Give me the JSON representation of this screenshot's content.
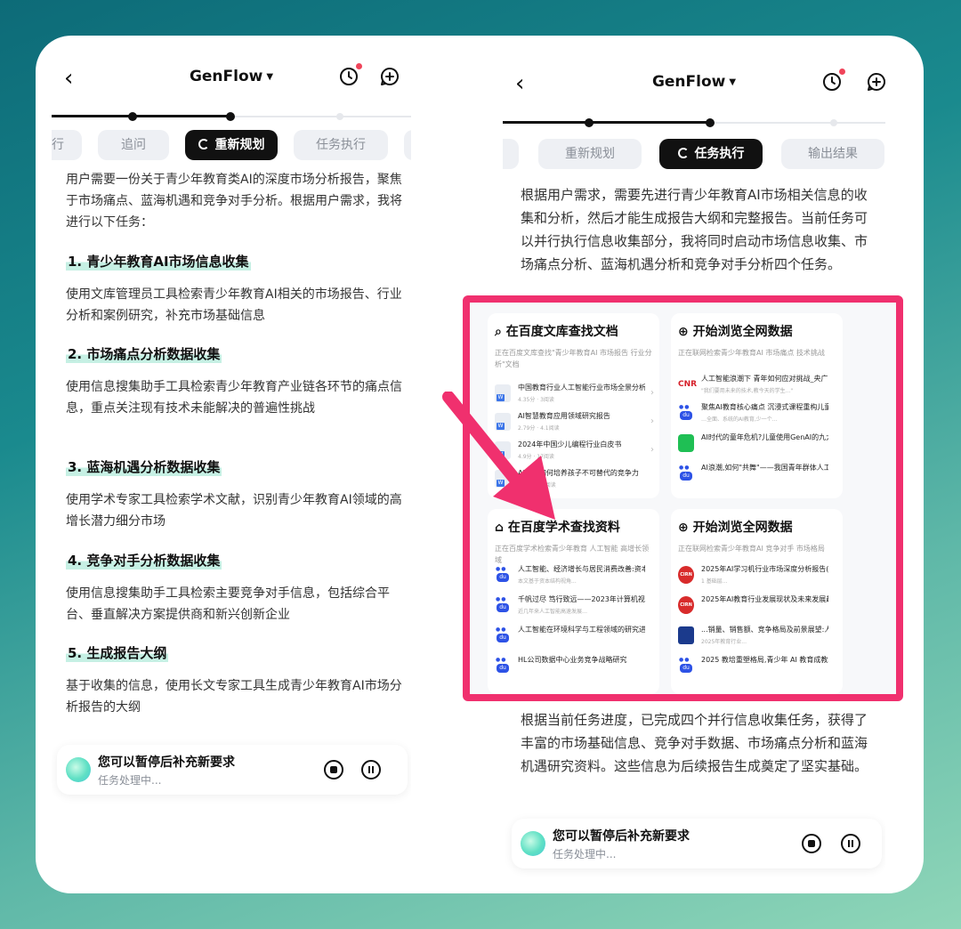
{
  "app": {
    "title": "GenFlow"
  },
  "left": {
    "tabs": [
      "行",
      "追问",
      "重新规划",
      "任务执行"
    ],
    "intro": "用户需要一份关于青少年教育类AI的深度市场分析报告，聚焦于市场痛点、蓝海机遇和竞争对手分析。根据用户需求，我将进行以下任务：",
    "sections": [
      {
        "title": "1. 青少年教育AI市场信息收集",
        "body": "使用文库管理员工具检索青少年教育AI相关的市场报告、行业分析和案例研究，补充市场基础信息"
      },
      {
        "title": "2. 市场痛点分析数据收集",
        "body": "使用信息搜集助手工具检索青少年教育产业链各环节的痛点信息，重点关注现有技术未能解决的普遍性挑战"
      },
      {
        "title": "3. 蓝海机遇分析数据收集",
        "body": "使用学术专家工具检索学术文献，识别青少年教育AI领域的高增长潜力细分市场"
      },
      {
        "title": "4. 竞争对手分析数据收集",
        "body": "使用信息搜集助手工具检索主要竞争对手信息，包括综合平台、垂直解决方案提供商和新兴创新企业"
      },
      {
        "title": "5. 生成报告大纲",
        "body": "基于收集的信息，使用长文专家工具生成青少年教育AI市场分析报告的大纲"
      }
    ],
    "bottom": {
      "title": "您可以暂停后补充新要求",
      "status": "任务处理中..."
    }
  },
  "right": {
    "tabs": [
      "重新规划",
      "任务执行",
      "输出结果"
    ],
    "intro": "根据用户需求，需要先进行青少年教育AI市场相关信息的收集和分析，然后才能生成报告大纲和完整报告。当前任务可以并行执行信息收集部分，我将同时启动市场信息收集、市场痛点分析、蓝海机遇分析和竞争对手分析四个任务。",
    "panels": [
      {
        "title": "在百度文库查找文档",
        "sub": "正在百度文库查找\"青少年教育AI 市场报告 行业分析\"文档",
        "items": [
          {
            "t": "中国教育行业人工智能行业市场全景分析...",
            "s": "4.35分 · 3阅读",
            "icon": "doc"
          },
          {
            "t": "AI智慧教育应用领域研究报告",
            "s": "2.79分 · 4.1阅读",
            "icon": "doc"
          },
          {
            "t": "2024年中国少儿编程行业白皮书",
            "s": "4.9分 · 17阅读",
            "icon": "doc"
          },
          {
            "t": "AI时代如何培养孩子不可替代的竞争力",
            "s": "3.7分 · 4.1阅读",
            "icon": "doc"
          }
        ]
      },
      {
        "title": "开始浏览全网数据",
        "sub": "正在联网检索青少年教育AI 市场痛点 技术挑战",
        "items": [
          {
            "t": "人工智能浪潮下 青年如何应对挑战_央广网",
            "s": "\"我们要用未来的技术,教今天的学生...\"",
            "icon": "cnr"
          },
          {
            "t": "聚焦AI教育核心痛点 沉浸式课程重构儿童AI...",
            "s": "…全面、系统的AI教育,少一个…",
            "icon": "baidu"
          },
          {
            "t": "AI时代的童年危机?儿童使用GenAI的九大挑...",
            "s": "",
            "icon": "wechat"
          },
          {
            "t": "AI浪潮,如何\"共舞\"——我国青年群体人工智...",
            "s": "",
            "icon": "baidu"
          }
        ]
      },
      {
        "title": "在百度学术查找资料",
        "sub": "正在百度学术检索青少年教育 人工智能 高增长领域",
        "items": [
          {
            "t": "人工智能、经济增长与居民消费改善:资本结...",
            "s": "本文基于资本结构视角...",
            "icon": "baidu"
          },
          {
            "t": "千帆过尽 笃行致远——2023年计算机视觉安...",
            "s": "近几年来人工智能高速发展…",
            "icon": "baidu"
          },
          {
            "t": "人工智能在环境科学与工程领域的研究进展",
            "s": "",
            "icon": "baidu"
          },
          {
            "t": "HL公司数据中心业务竞争战略研究",
            "s": "",
            "icon": "baidu"
          }
        ]
      },
      {
        "title": "开始浏览全网数据",
        "sub": "正在联网检索青少年教育AI 竞争对手 市场格局",
        "items": [
          {
            "t": "2025年AI学习机行业市场深度分析报告(附...",
            "s": "1 基础层...",
            "icon": "cirn"
          },
          {
            "t": "2025年AI教育行业发展现状及未来发展趋势...",
            "s": "",
            "icon": "cirn"
          },
          {
            "t": "...销量、销售额、竞争格局及前景展望:人工...",
            "s": "2025年教育行业...",
            "icon": "blue"
          },
          {
            "t": "2025 教培重塑格局,青少年 AI 教育成教培机...",
            "s": "",
            "icon": "baidu"
          }
        ]
      }
    ],
    "outro": "根据当前任务进度，已完成四个并行信息收集任务，获得了丰富的市场基础信息、竞争对手数据、市场痛点分析和蓝海机遇研究资料。这些信息为后续报告生成奠定了坚实基础。",
    "bottom": {
      "title": "您可以暂停后补充新要求",
      "status": "任务处理中..."
    }
  },
  "colors": {
    "highlight": "#f0306e",
    "accent": "#111111"
  }
}
